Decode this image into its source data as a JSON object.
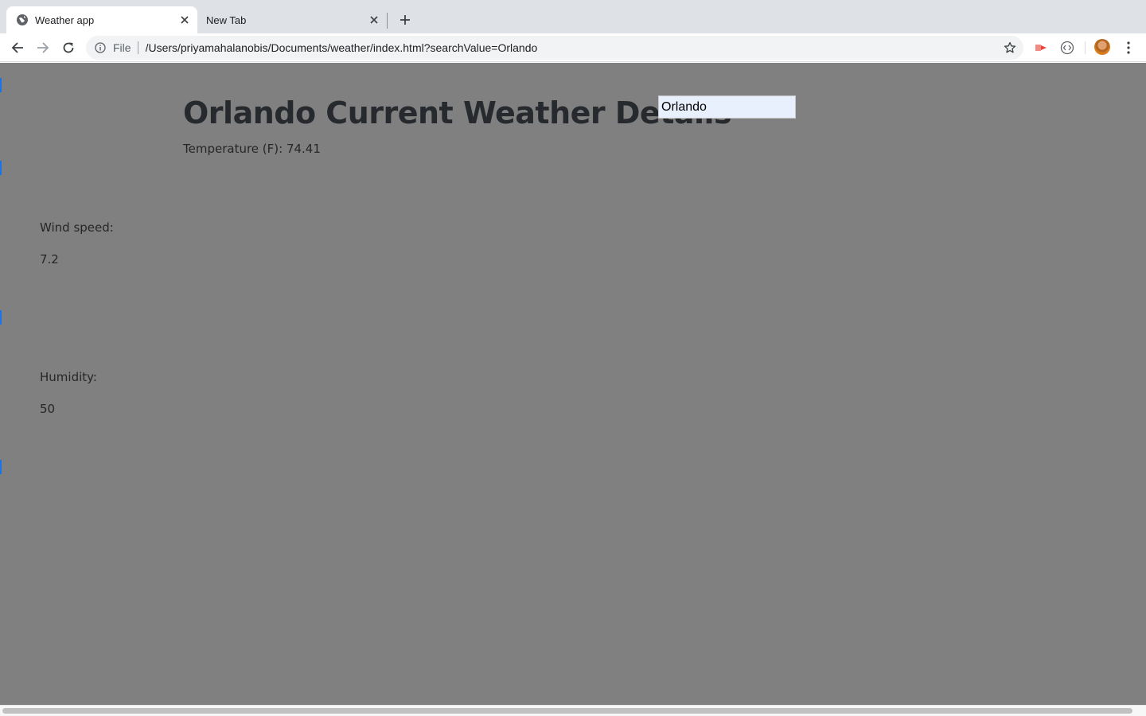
{
  "browser": {
    "tabs": [
      {
        "title": "Weather app",
        "active": true,
        "favicon": "globe-icon"
      },
      {
        "title": "New Tab",
        "active": false
      }
    ],
    "omnibox": {
      "scheme": "File",
      "url": "/Users/priyamahalanobis/Documents/weather/index.html?searchValue=Orlando"
    },
    "icons": {
      "back": "arrow-left-icon",
      "forward": "arrow-right-icon",
      "reload": "reload-icon",
      "info": "info-icon",
      "bookmark": "star-icon",
      "extension_1": "cast-extension-icon",
      "extension_2": "code-extension-icon",
      "menu": "kebab-menu-icon"
    }
  },
  "page": {
    "heading": "Orlando Current Weather Details",
    "search": {
      "value": "Orlando"
    },
    "temperature_text": "Temperature (F): 74.41",
    "wind": {
      "label": "Wind speed:",
      "value": "7.2"
    },
    "humidity": {
      "label": "Humidity:",
      "value": "50"
    }
  },
  "colors": {
    "page_background": "#808080",
    "tabstrip": "#dee1e6",
    "marker": "#1a73e8",
    "search_background": "#e8f0fe"
  }
}
